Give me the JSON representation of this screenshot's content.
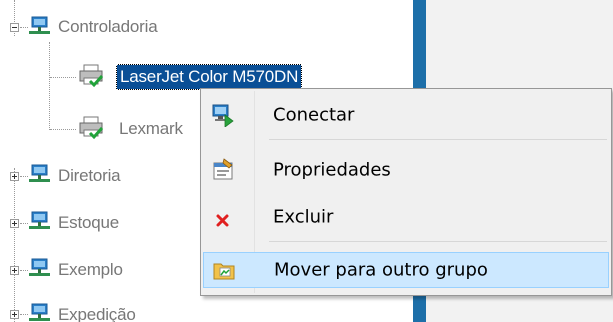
{
  "tree": {
    "nodes": [
      {
        "label": "Controladoria",
        "expanded": true
      },
      {
        "label": "LaserJet Color M570DN",
        "selected": true
      },
      {
        "label": "Lexmark"
      },
      {
        "label": "Diretoria",
        "expanded": false
      },
      {
        "label": "Estoque",
        "expanded": false
      },
      {
        "label": "Exemplo",
        "expanded": false
      },
      {
        "label": "Expedição",
        "expanded": false
      }
    ]
  },
  "context_menu": {
    "items": [
      {
        "label": "Conectar",
        "icon": "connect-computer-icon"
      },
      {
        "label": "Propriedades",
        "icon": "properties-icon"
      },
      {
        "label": "Excluir",
        "icon": "delete-x-icon"
      },
      {
        "label": "Mover para outro grupo",
        "icon": "move-group-icon",
        "highlighted": true
      }
    ]
  },
  "colors": {
    "selection": "#0a4f96",
    "splitter": "#1d6fa9",
    "menu_highlight": "#cce8ff",
    "menu_background": "#f0f0f0",
    "tree_text": "#777777"
  }
}
